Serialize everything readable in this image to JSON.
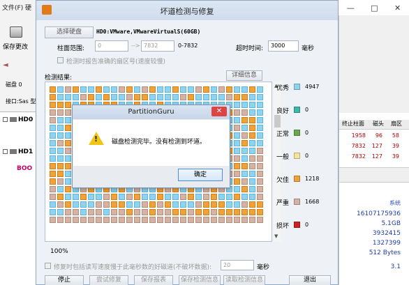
{
  "bg_app": {
    "menu": "文件(F)   硬",
    "save_label": "保存更改",
    "save_suffix": "撤",
    "disk_label": "磁盘 0",
    "interface": "接口:Sas  型",
    "tree": [
      "HD0",
      "HD1",
      "BOO"
    ],
    "columns": [
      "终止柱面",
      "磁头",
      "扇区"
    ],
    "rows": [
      [
        "1958",
        "96",
        "58"
      ],
      [
        "7832",
        "127",
        "39"
      ],
      [
        "7832",
        "127",
        "39"
      ]
    ],
    "sys_label": "系统",
    "values": [
      "16107175936",
      "5.1GB",
      "3932415",
      "1327399",
      "512 Bytes",
      "3.1"
    ]
  },
  "dialog": {
    "title": "坏道检测与修复",
    "select_disk_btn": "选择硬盘",
    "disk_name": "HD0:VMware,VMwareVirtualS(60GB)",
    "cyl_range_label": "柱面范围:",
    "cyl_from": "0",
    "cyl_arrow": "-->",
    "cyl_to": "7832",
    "cyl_range_text": "0-7832",
    "timeout_label": "超时时间:",
    "timeout_value": "3000",
    "timeout_unit": "毫秒",
    "check_exact_label": "检测时报告准确的扇区号(速度较慢)",
    "result_label": "检测结果:",
    "detail_btn": "详细信息",
    "progress": "100%",
    "repair_label": "修复时包括读写速度慢于此毫秒数的好磁道(不破坏数据):",
    "repair_value": "20",
    "repair_unit": "毫秒",
    "buttons": {
      "stop": "停止",
      "try_repair": "尝试修复",
      "save_report": "保存报表",
      "save_info": "保存检测信息",
      "read_info": "读取检测信息",
      "exit": "退出"
    }
  },
  "legend": [
    {
      "label": "优秀",
      "color": "#8fd3ef",
      "value": "4947"
    },
    {
      "label": "良好",
      "color": "#3bb8a8",
      "value": "0"
    },
    {
      "label": "正常",
      "color": "#6aa84f",
      "value": "0"
    },
    {
      "label": "一般",
      "color": "#f4e39a",
      "value": "0"
    },
    {
      "label": "欠佳",
      "color": "#f0a23a",
      "value": "1218"
    },
    {
      "label": "严重",
      "color": "#d5b3a4",
      "value": "1668"
    },
    {
      "label": "损坏",
      "color": "#cc2222",
      "value": "0"
    }
  ],
  "message_box": {
    "title": "PartitionGuru",
    "close": "✕",
    "text": "磁盘检测完毕。没有检测到坏道。",
    "ok": "确定"
  },
  "window_controls": [
    "—",
    "□",
    "✕"
  ]
}
